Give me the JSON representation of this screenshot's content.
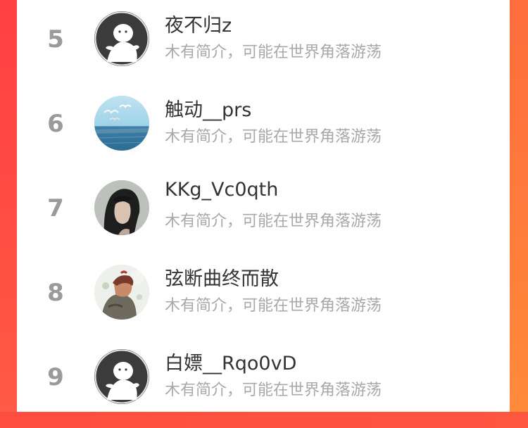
{
  "users": [
    {
      "rank": "5",
      "name": "夜不归z",
      "bio": "木有简介，可能在世界角落游荡",
      "avatar": "default-avatar-icon"
    },
    {
      "rank": "6",
      "name": "触动__prs",
      "bio": "木有简介，可能在世界角落游荡",
      "avatar": "seagulls-photo"
    },
    {
      "rank": "7",
      "name": "KKg_Vc0qth",
      "bio": "木有简介，可能在世界角落游荡",
      "avatar": "portrait-photo"
    },
    {
      "rank": "8",
      "name": "弦断曲终而散",
      "bio": "木有简介，可能在世界角落游荡",
      "avatar": "anime-illustration"
    },
    {
      "rank": "9",
      "name": "白嫖__Rqo0vD",
      "bio": "木有简介，可能在世界角落游荡",
      "avatar": "default-avatar-icon"
    }
  ]
}
